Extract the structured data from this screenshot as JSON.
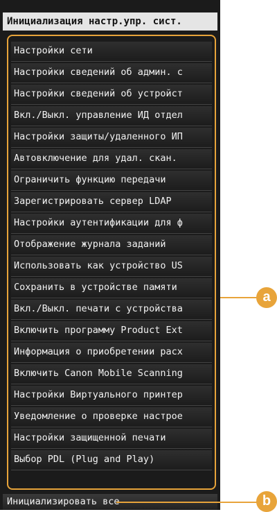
{
  "header": {
    "title": "Инициализация настр.упр. сист."
  },
  "menu": {
    "items": [
      "Настройки сети",
      "Настройки сведений об админ. с",
      "Настройки сведений об устройст",
      "Вкл./Выкл. управление ИД отдел",
      "Настройки защиты/удаленного ИП",
      "Автовключение для удал. скан.",
      "Ограничить функцию передачи",
      "Зарегистрировать сервер LDAP",
      "Настройки аутентификации для ф",
      "Отображение журнала заданий",
      "Использовать как устройство US",
      "Сохранить в устройстве памяти",
      "Вкл./Выкл. печати с устройства",
      "Включить программу Product Ext",
      "Информация о приобретении расх",
      "Включить Canon Mobile Scanning",
      "Настройки Виртуального принтер",
      "Уведомление о проверке настрое",
      "Настройки защищенной печати",
      "Выбор PDL (Plug and Play)"
    ]
  },
  "footer": {
    "initialize_all": "Инициализировать все"
  },
  "callouts": {
    "a": "a",
    "b": "b"
  },
  "colors": {
    "accent": "#e8a43a"
  }
}
